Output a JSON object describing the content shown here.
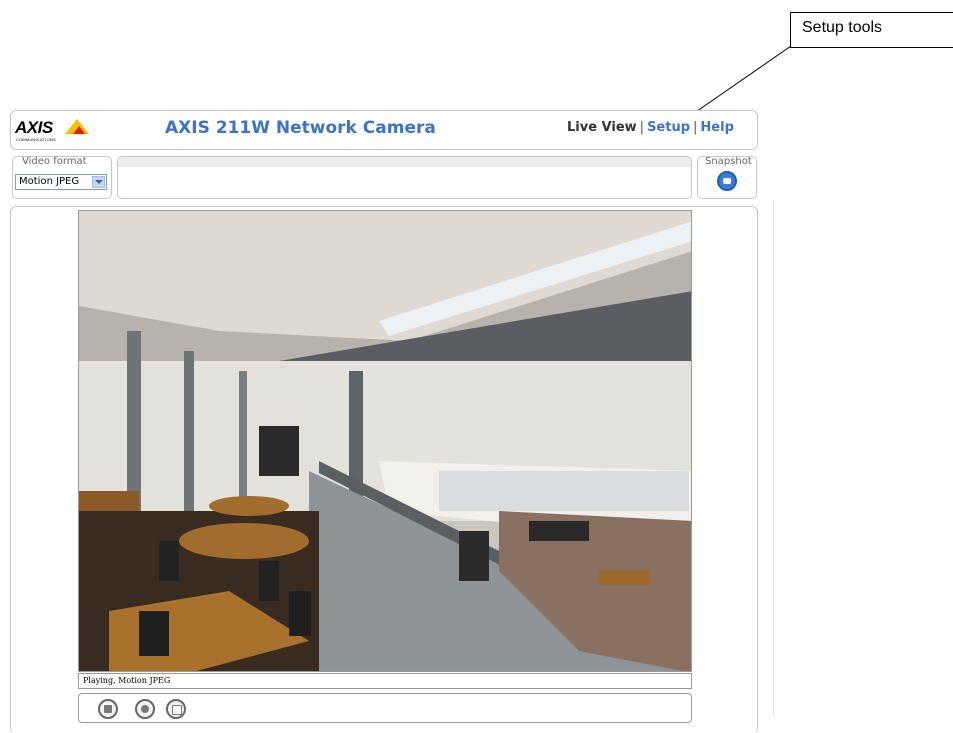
{
  "annotation": {
    "label": "Setup tools"
  },
  "header": {
    "logo_text": "AXIS",
    "logo_sub": "COMMUNICATIONS",
    "title": "AXIS 211W Network Camera",
    "nav": {
      "live_view": "Live View",
      "setup": "Setup",
      "help": "Help",
      "separator": "|"
    }
  },
  "video_format": {
    "label": "Video format",
    "selected": "Motion JPEG"
  },
  "snapshot": {
    "label": "Snapshot",
    "icon": "camera-icon"
  },
  "viewer": {
    "image_description_icon": "live-video-image",
    "status": "Playing, Motion JPEG",
    "controls": [
      {
        "name": "stop-icon"
      },
      {
        "name": "snapshot-icon"
      },
      {
        "name": "view-full-screen-icon"
      }
    ]
  },
  "colors": {
    "title_blue": "#3b73c8",
    "border_gray": "#c7c7c7",
    "logo_yellow": "#f2c200",
    "logo_red": "#e8191c"
  }
}
